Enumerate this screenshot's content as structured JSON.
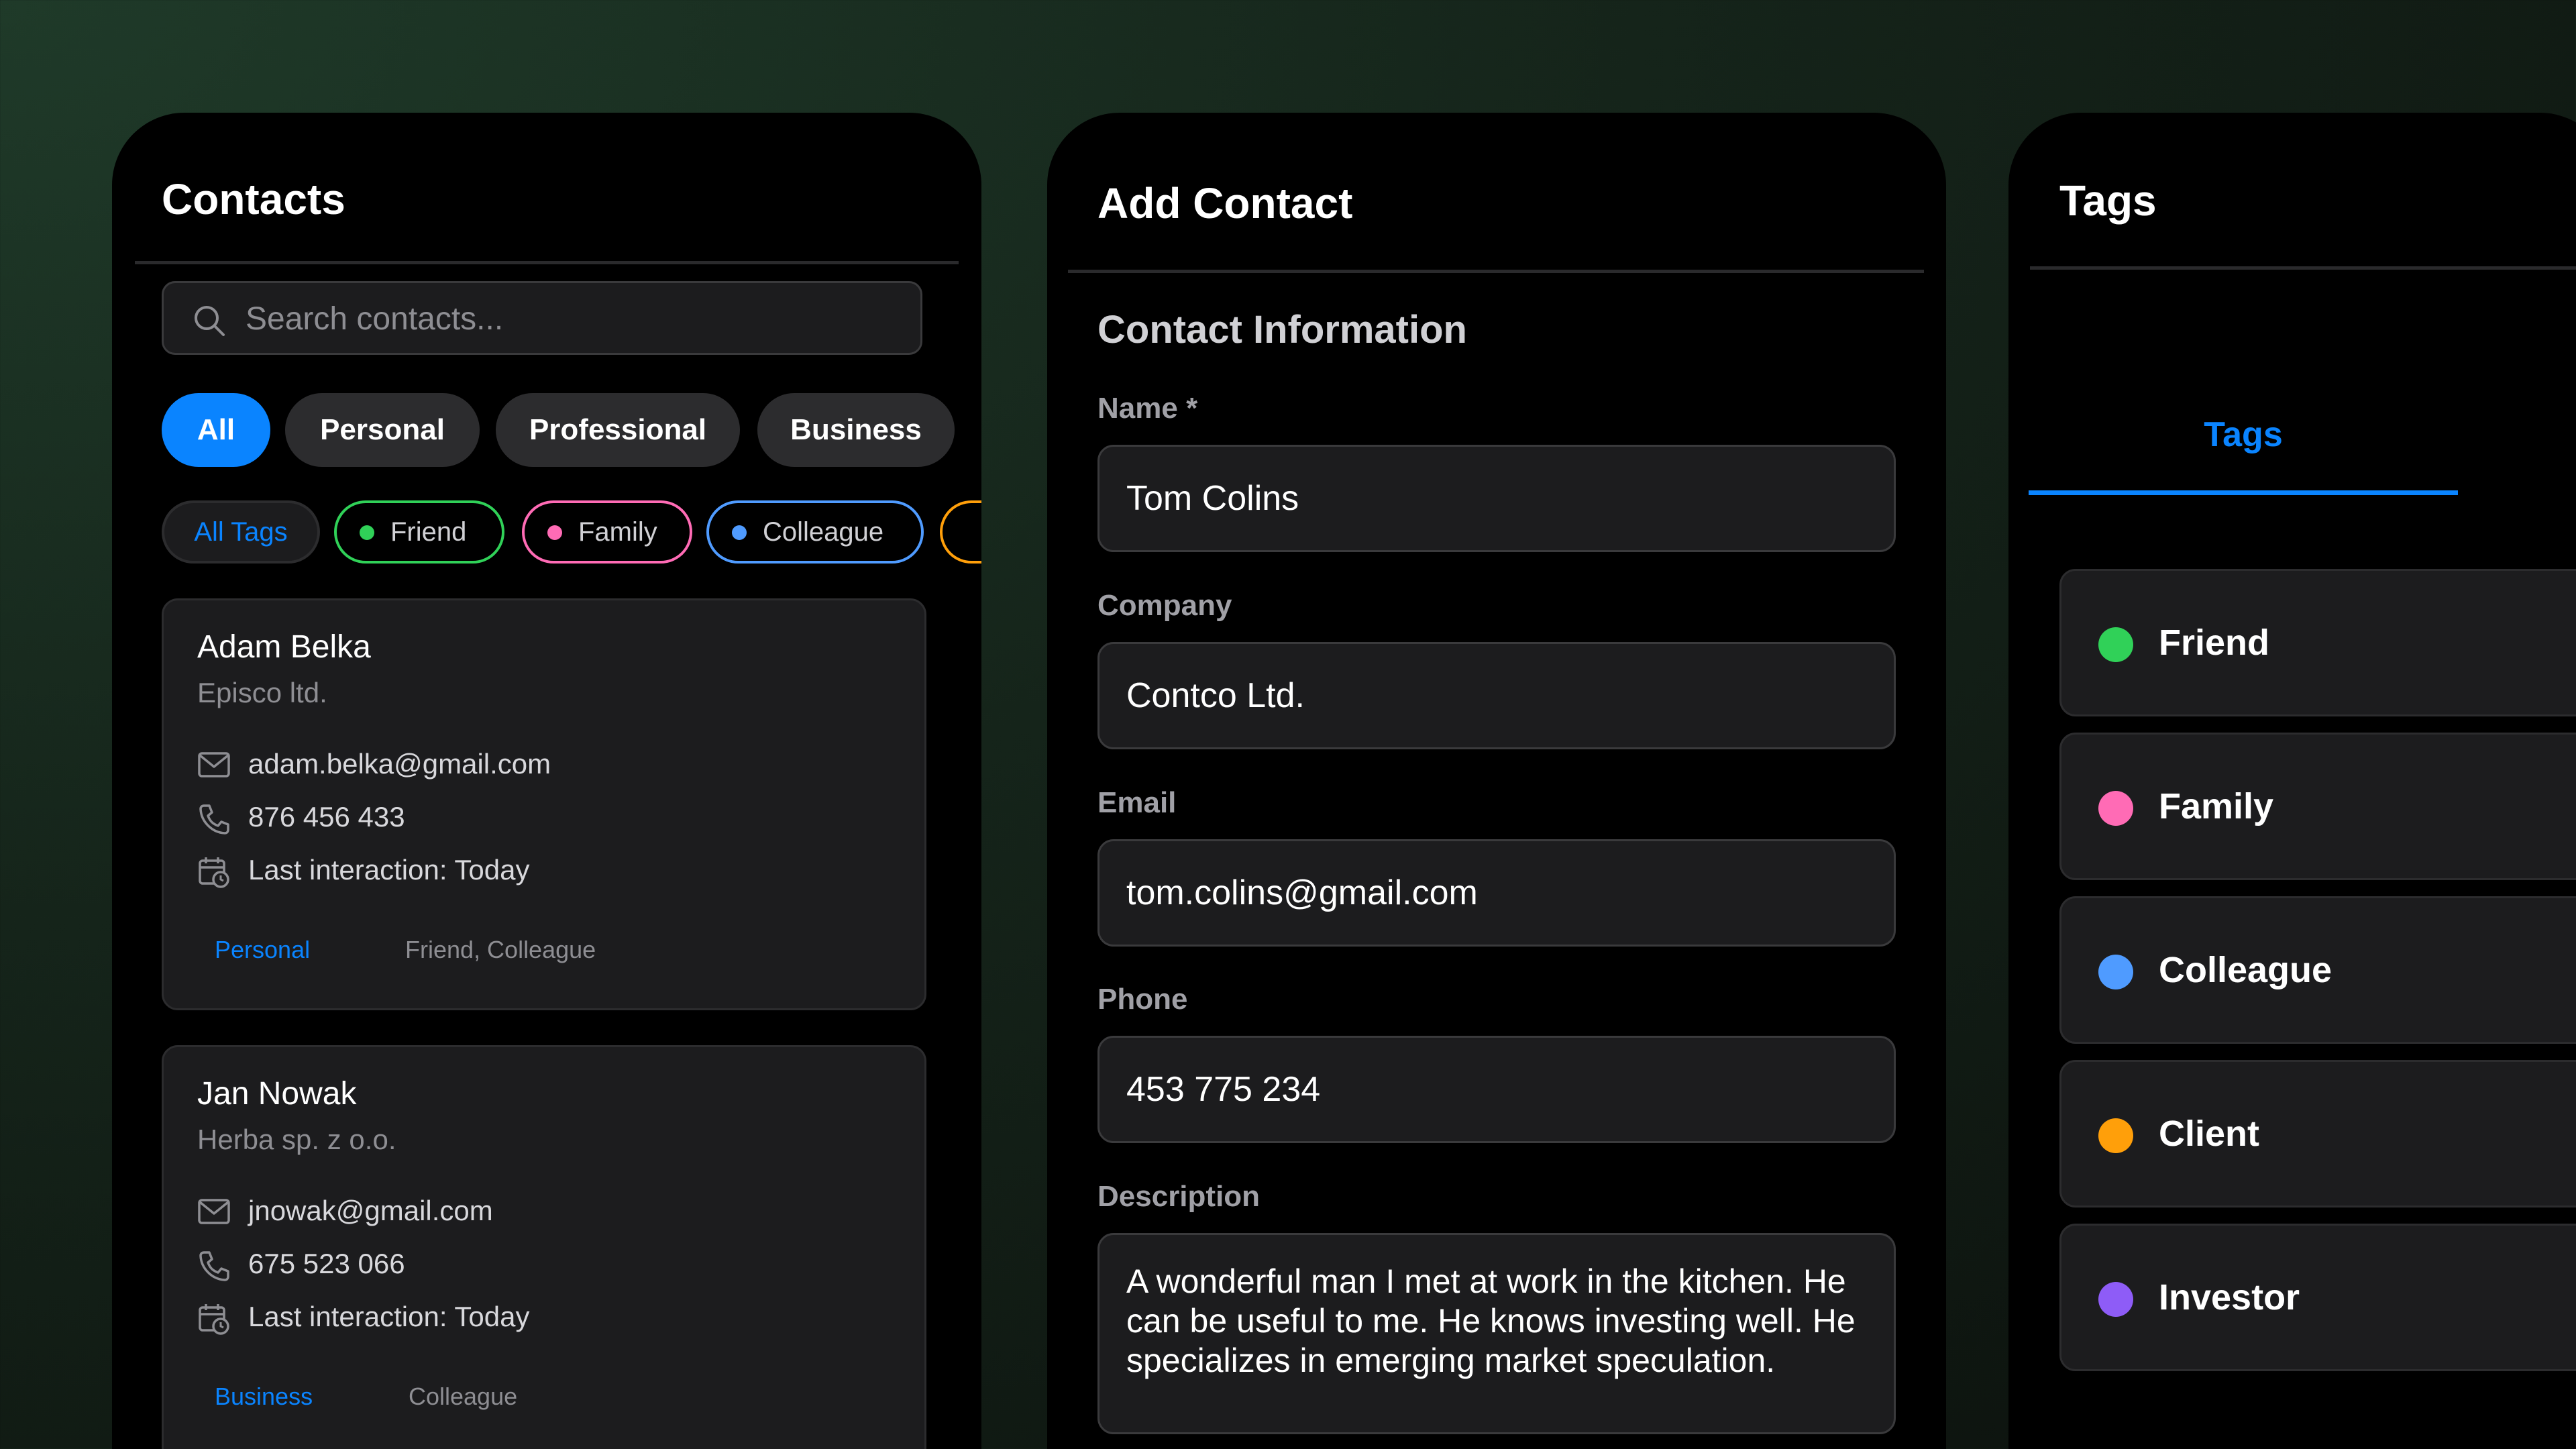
{
  "contacts_screen": {
    "title": "Contacts",
    "search_placeholder": "Search contacts...",
    "categories": [
      "All",
      "Personal",
      "Professional",
      "Business"
    ],
    "tag_filters": [
      {
        "label": "All Tags"
      },
      {
        "label": "Friend",
        "color": "#30d158"
      },
      {
        "label": "Family",
        "color": "#ff6bb5"
      },
      {
        "label": "Colleague",
        "color": "#4f9bff"
      },
      {
        "label": "",
        "color": "#ff9f0a"
      }
    ],
    "contacts": [
      {
        "name": "Adam Belka",
        "company": "Episco ltd.",
        "email": "adam.belka@gmail.com",
        "phone": "876 456 433",
        "last_interaction": "Last interaction: Today",
        "category": "Personal",
        "tags": "Friend, Colleague"
      },
      {
        "name": "Jan Nowak",
        "company": "Herba sp. z o.o.",
        "email": "jnowak@gmail.com",
        "phone": "675 523 066",
        "last_interaction": "Last interaction: Today",
        "category": "Business",
        "tags": "Colleague"
      }
    ]
  },
  "add_contact_screen": {
    "title": "Add Contact",
    "section": "Contact Information",
    "fields": {
      "name": {
        "label": "Name *",
        "value": "Tom Colins"
      },
      "company": {
        "label": "Company",
        "value": "Contco Ltd."
      },
      "email": {
        "label": "Email",
        "value": "tom.colins@gmail.com"
      },
      "phone": {
        "label": "Phone",
        "value": "453 775 234"
      },
      "description": {
        "label": "Description",
        "value": "A wonderful man I met at work in the kitchen. He can be useful to me. He knows investing well. He specializes in emerging market speculation."
      }
    }
  },
  "tags_screen": {
    "title": "Tags",
    "tab": "Tags",
    "tags": [
      {
        "label": "Friend",
        "color": "#30d158"
      },
      {
        "label": "Family",
        "color": "#ff6bb5"
      },
      {
        "label": "Colleague",
        "color": "#4f9bff"
      },
      {
        "label": "Client",
        "color": "#ff9f0a"
      },
      {
        "label": "Investor",
        "color": "#8e5cf7"
      }
    ]
  },
  "colors": {
    "accent": "#0a84ff",
    "card_background": "#1c1c1e",
    "screen_background": "#000000"
  }
}
